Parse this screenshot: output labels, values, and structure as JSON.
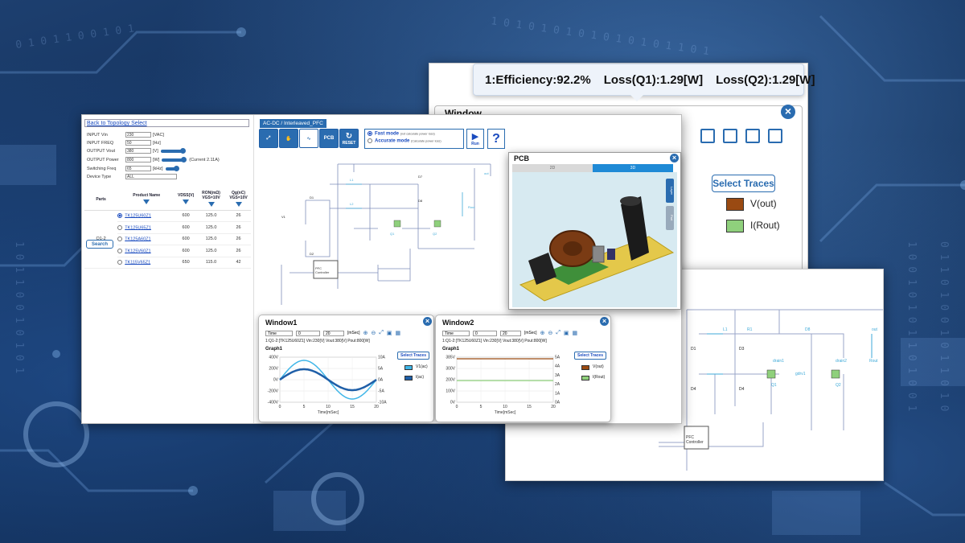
{
  "tooltip": {
    "efficiency": "1:Efficiency:92.2%",
    "loss_q1": "Loss(Q1):1.29[W]",
    "loss_q2": "Loss(Q2):1.29[W]"
  },
  "back_window": {
    "title": "Window",
    "select_traces": "Select Traces",
    "legend": [
      {
        "label": "V(out)",
        "color": "#9a4a12"
      },
      {
        "label": "I(Rout)",
        "color": "#8fd07c"
      }
    ]
  },
  "main": {
    "back_link": "Back to Topology Select",
    "topology_title": "AC-DC / Interleaved_PFC",
    "params": [
      {
        "label": "INPUT Vin",
        "value": "230",
        "unit": "[VAC]"
      },
      {
        "label": "INPUT FREQ",
        "value": "50",
        "unit": "[Hz]"
      },
      {
        "label": "OUTPUT Vout",
        "value": "380",
        "unit": "[V]"
      },
      {
        "label": "OUTPUT Power",
        "value": "800",
        "unit": "[W]",
        "note": "(Current 2.11A)"
      },
      {
        "label": "Switching Freq",
        "value": "65",
        "unit": "[kHz]"
      },
      {
        "label": "Device Type",
        "value": "ALL",
        "unit": ""
      }
    ],
    "table": {
      "headers": [
        "Parts",
        "Product Name",
        "VDSS(V)",
        "RON(mΩ) VGS=10V",
        "Qg(nC) VGS=10V"
      ],
      "group_label": "Q1-2",
      "search_label": "Search",
      "rows": [
        {
          "name": "TK125U60Z1",
          "vdss": "600",
          "ron": "125.0",
          "qg": "26",
          "selected": true
        },
        {
          "name": "TK125U65Z1",
          "vdss": "600",
          "ron": "125.0",
          "qg": "26",
          "selected": false
        },
        {
          "name": "TK125A60Z1",
          "vdss": "600",
          "ron": "125.0",
          "qg": "26",
          "selected": false
        },
        {
          "name": "TK125V60Z1",
          "vdss": "600",
          "ron": "125.0",
          "qg": "26",
          "selected": false
        },
        {
          "name": "TK115V65Z1",
          "vdss": "650",
          "ron": "115.0",
          "qg": "42",
          "selected": false
        }
      ]
    },
    "toolbar": {
      "pcb": "PCB",
      "reset": "RESET",
      "fast_mode": "Fast mode",
      "fast_mode_sub": "(not calculate power loss)",
      "accurate_mode": "Accurate mode",
      "accurate_mode_sub": "(Calculate power loss)",
      "run": "Run",
      "help": "?"
    }
  },
  "window1": {
    "title": "Window1",
    "time_select": "Time",
    "t_from": "0",
    "t_to": "20",
    "t_unit": "[mSec]",
    "info": "1:Q1-2:[TK125U60Z1] Vin:230[V] Vout:380[V] Pout:800[W]",
    "graph": "Graph1",
    "select_traces": "Select Traces",
    "legend": [
      {
        "label": "V1(ac)",
        "color": "#3fb6e8"
      },
      {
        "label": "I(ac)",
        "color": "#1f5fa8"
      }
    ],
    "y_left": [
      "400V",
      "200V",
      "0V",
      "-200V",
      "-400V"
    ],
    "y_right": [
      "10A",
      "5A",
      "0A",
      "-5A",
      "-10A"
    ],
    "x_ticks": [
      "0",
      "5",
      "10",
      "15",
      "20"
    ],
    "xlabel": "Time[mSec]"
  },
  "window2": {
    "title": "Window2",
    "time_select": "Time",
    "t_from": "0",
    "t_to": "20",
    "t_unit": "[mSec]",
    "info": "1:Q1-2:[TK125U60Z1] Vin:230[V] Vout:380[V] Pout:800[W]",
    "graph": "Graph1",
    "select_traces": "Select Traces",
    "legend": [
      {
        "label": "V(out)",
        "color": "#9a4a12"
      },
      {
        "label": "I(Rout)",
        "color": "#8fd07c"
      }
    ],
    "y_left": [
      "385V",
      "300V",
      "200V",
      "100V",
      "0V"
    ],
    "y_right": [
      "5A",
      "4A",
      "3A",
      "2A",
      "1A",
      "0A"
    ],
    "x_ticks": [
      "0",
      "5",
      "10",
      "15",
      "20"
    ],
    "xlabel": "Time[mSec]"
  },
  "pcb": {
    "title": "PCB",
    "tab_2d": "2D",
    "tab_3d": "3D",
    "side_tab1": "Layer",
    "side_tab2": "Part"
  },
  "schematic": {
    "controller": "PFC Controller",
    "labels": [
      "D1",
      "D2",
      "D3",
      "D4",
      "D5",
      "D6",
      "D7",
      "D8",
      "L1",
      "L2",
      "Q1",
      "Q2",
      "C1",
      "Rout",
      "gdrv1",
      "gdrv2",
      "drain1",
      "drain2",
      "out",
      "V1"
    ]
  }
}
